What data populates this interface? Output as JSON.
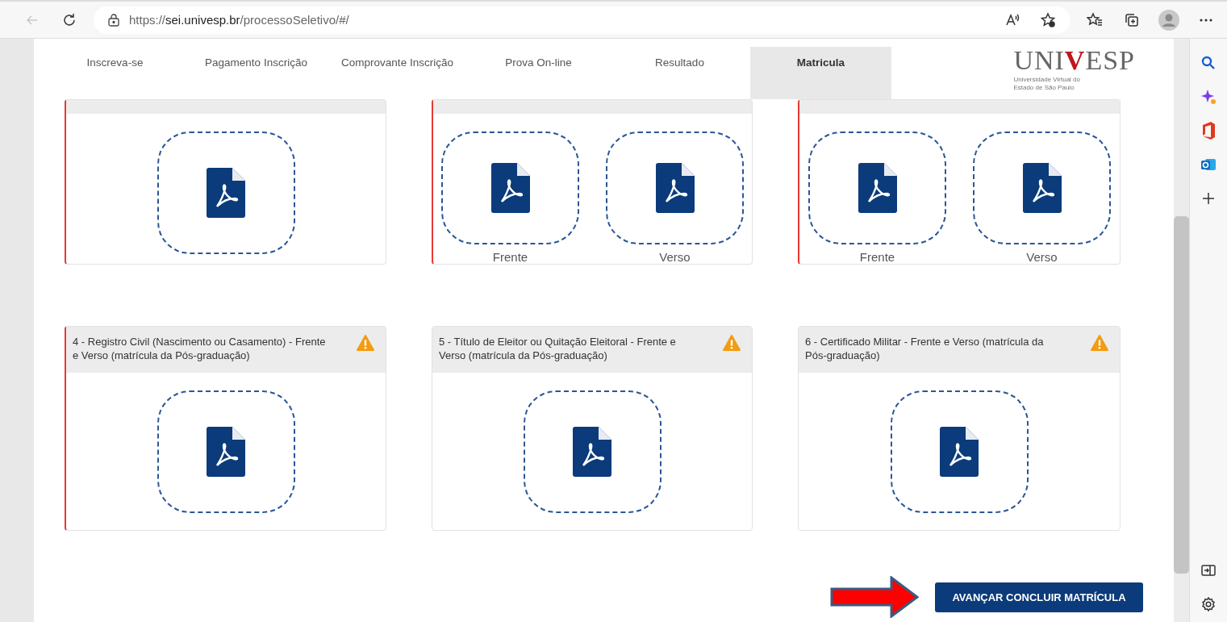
{
  "browser": {
    "url": "https://**sei.univesp.br**/processoSeletivo/#/",
    "back_disabled": true
  },
  "nav": {
    "tabs": [
      {
        "label": "Inscreva-se",
        "selected": false
      },
      {
        "label": "Pagamento Inscrição",
        "selected": false
      },
      {
        "label": "Comprovante Inscrição",
        "selected": false
      },
      {
        "label": "Prova On-line",
        "selected": false
      },
      {
        "label": "Resultado",
        "selected": false
      },
      {
        "label": "Matricula",
        "selected": true
      }
    ],
    "logo": {
      "left": "UNI",
      "mark": "V",
      "right": "ESP",
      "subtitle": "Universidade Virtual do Estado de São Paulo"
    }
  },
  "documents": [
    {
      "flagged": true,
      "uploads": [
        {
          "kind": "plain"
        }
      ]
    },
    {
      "flagged": true,
      "uploads": [
        {
          "kind": "labeled",
          "label": "Frente"
        },
        {
          "kind": "labeled",
          "label": "Verso"
        }
      ]
    },
    {
      "flagged": true,
      "uploads": [
        {
          "kind": "labeled",
          "label": "Frente"
        },
        {
          "kind": "labeled",
          "label": "Verso"
        }
      ]
    },
    {
      "title": "4 - Registro Civil (Nascimento ou Casamento) - Frente e Verso (matrícula da Pós-graduação)",
      "flagged": true,
      "warning": true,
      "uploads": [
        {
          "kind": "plain"
        }
      ]
    },
    {
      "title": "5 - Título de Eleitor ou Quitação Eleitoral - Frente e Verso (matrícula da Pós-graduação)",
      "flagged": false,
      "warning": true,
      "uploads": [
        {
          "kind": "plain"
        }
      ]
    },
    {
      "title": "6 - Certificado Militar - Frente e Verso (matrícula da Pós-graduação)",
      "flagged": false,
      "warning": true,
      "uploads": [
        {
          "kind": "plain"
        }
      ]
    }
  ],
  "submit": {
    "label": "AVANÇAR CONCLUIR MATRÍCULA"
  }
}
